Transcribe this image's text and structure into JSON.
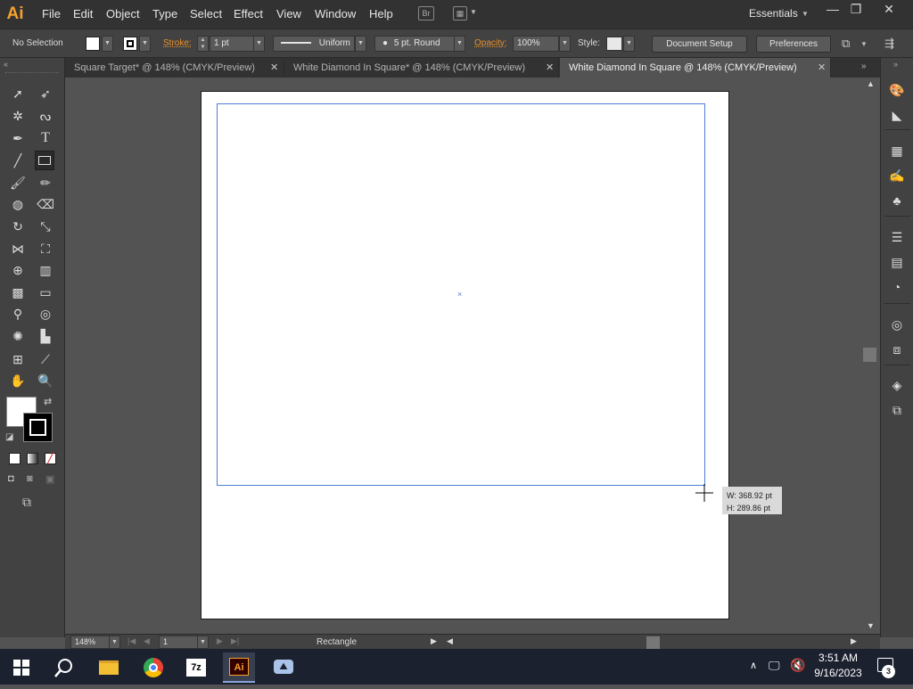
{
  "app": {
    "logo": "Ai",
    "workspace": "Essentials"
  },
  "menu": [
    "File",
    "Edit",
    "Object",
    "Type",
    "Select",
    "Effect",
    "View",
    "Window",
    "Help"
  ],
  "menubar_icons": {
    "bridge": "Br",
    "arrange": "arrange-documents-icon"
  },
  "window_controls": {
    "minimize": "—",
    "restore": "❐",
    "close": "✕"
  },
  "controlbar": {
    "selection": "No Selection",
    "stroke_label": "Stroke:",
    "stroke_weight": "1 pt",
    "profile": "Uniform",
    "brush": "5 pt. Round",
    "opacity_label": "Opacity:",
    "opacity": "100%",
    "style_label": "Style:",
    "document_setup": "Document Setup",
    "preferences": "Preferences"
  },
  "tabs": [
    {
      "label": "Square Target* @ 148% (CMYK/Preview)",
      "close": "✕"
    },
    {
      "label": "White Diamond In Square* @ 148% (CMYK/Preview)",
      "close": "✕"
    },
    {
      "label": "White Diamond In Square @ 148% (CMYK/Preview)",
      "close": "✕"
    }
  ],
  "canvas": {
    "measure_w": "W: 368.92 pt",
    "measure_h": "H: 289.86 pt"
  },
  "status": {
    "zoom": "148%",
    "artboard": "1",
    "tool": "Rectangle"
  },
  "taskbar": {
    "time": "3:51 AM",
    "date": "9/16/2023",
    "notifications": "3",
    "archiver_label": "7z",
    "ai_label": "Ai"
  },
  "colors": {
    "accent": "#f7a12c",
    "selection": "#4d7ed6",
    "label_orange": "#e8922a"
  }
}
